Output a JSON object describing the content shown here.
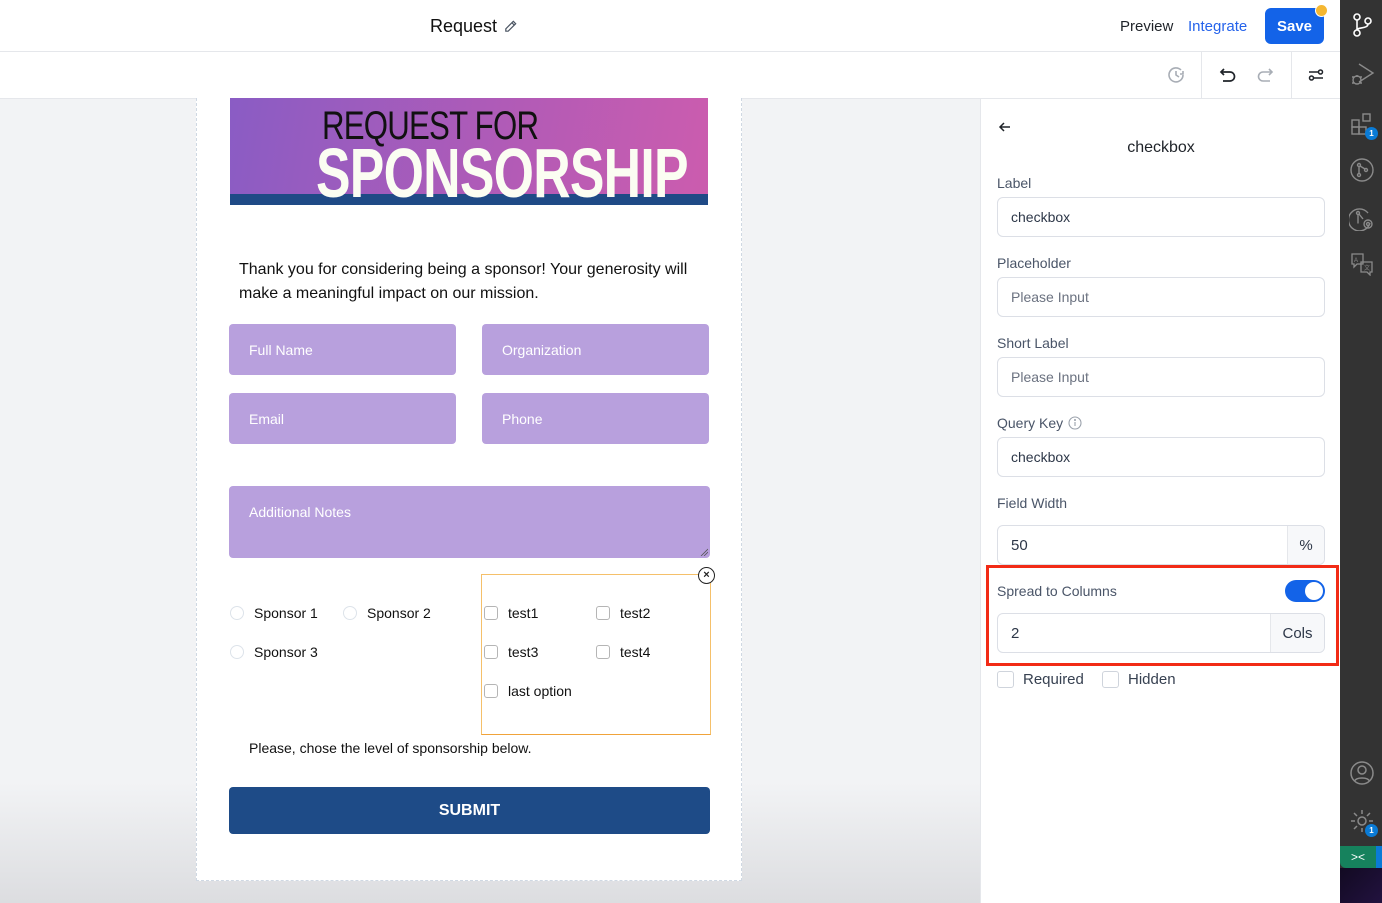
{
  "header": {
    "title": "Request",
    "preview_label": "Preview",
    "integrate_label": "Integrate",
    "save_label": "Save",
    "save_unsaved_indicator_color": "#f5b731",
    "accent_color": "#1363e8"
  },
  "toolbar": {
    "icons": [
      "history-icon",
      "undo-icon",
      "redo-icon",
      "settings-sliders-icon"
    ]
  },
  "form": {
    "banner": {
      "line1": "REQUEST FOR",
      "line2": "SPONSORSHIP"
    },
    "intro": "Thank you for considering being a sponsor! Your generosity will make a meaningful impact on our mission.",
    "fields": {
      "full_name": "Full Name",
      "organization": "Organization",
      "email": "Email",
      "phone": "Phone",
      "notes": "Additional Notes"
    },
    "radio_options": [
      "Sponsor 1",
      "Sponsor 2",
      "Sponsor 3"
    ],
    "checkbox_options": [
      "test1",
      "test2",
      "test3",
      "test4",
      "last option"
    ],
    "level_text": "Please, chose the level of sponsorship below.",
    "submit_label": "SUBMIT",
    "close_symbol": "×"
  },
  "panel": {
    "title": "checkbox",
    "label": {
      "label": "Label",
      "value": "checkbox"
    },
    "placeholder": {
      "label": "Placeholder",
      "placeholder": "Please Input"
    },
    "short_label": {
      "label": "Short Label",
      "placeholder": "Please Input"
    },
    "query_key": {
      "label": "Query Key",
      "value": "checkbox"
    },
    "field_width": {
      "label": "Field Width",
      "value": "50",
      "suffix": "%"
    },
    "spread": {
      "label": "Spread to Columns",
      "enabled": true,
      "value": "2",
      "suffix": "Cols"
    },
    "required_label": "Required",
    "hidden_label": "Hidden"
  },
  "activity_bar": {
    "items": [
      {
        "icon": "source-control-icon"
      },
      {
        "icon": "run-debug-icon"
      },
      {
        "icon": "extensions-icon",
        "badge": "1"
      },
      {
        "icon": "git-graph-icon"
      },
      {
        "icon": "git-lens-icon"
      },
      {
        "icon": "translate-icon"
      },
      {
        "icon": "account-icon"
      },
      {
        "icon": "manage-gear-icon",
        "badge": "1"
      }
    ],
    "remote_symbol": "><"
  }
}
